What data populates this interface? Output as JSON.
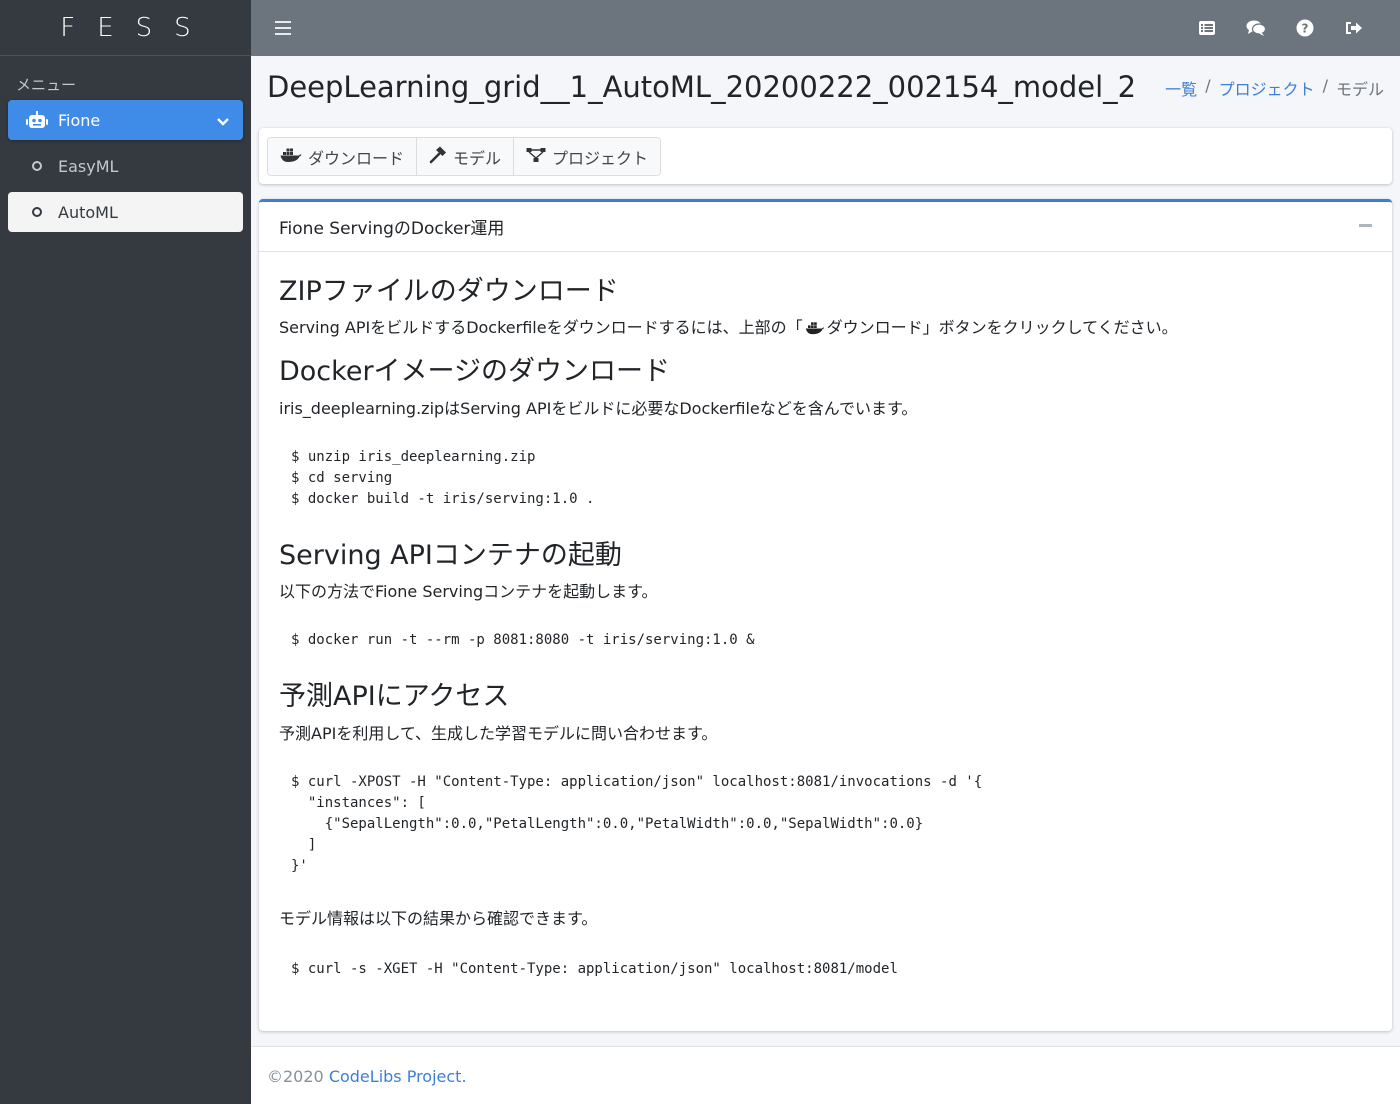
{
  "brand": {
    "text": "FESS"
  },
  "sidebar": {
    "header": "メニュー",
    "items": [
      {
        "label": "Fione"
      },
      {
        "label": "EasyML"
      },
      {
        "label": "AutoML"
      }
    ]
  },
  "header": {
    "title": "DeepLearning_grid__1_AutoML_20200222_002154_model_2",
    "breadcrumb": [
      "一覧",
      "プロジェクト",
      "モデル"
    ]
  },
  "toolbar": {
    "download_label": "ダウンロード",
    "model_label": "モデル",
    "project_label": "プロジェクト"
  },
  "card": {
    "title": "Fione ServingのDocker運用",
    "sections": [
      {
        "heading": "ZIPファイルのダウンロード",
        "text_before": "Serving APIをビルドするDockerfileをダウンロードするには、上部の「",
        "text_after": "ダウンロード」ボタンをクリックしてください。"
      },
      {
        "heading": "Dockerイメージのダウンロード",
        "text": "iris_deeplearning.zipはServing APIをビルドに必要なDockerfileなどを含んでいます。",
        "code": "$ unzip iris_deeplearning.zip\n$ cd serving\n$ docker build -t iris/serving:1.0 ."
      },
      {
        "heading": "Serving APIコンテナの起動",
        "text": "以下の方法でFione Servingコンテナを起動します。",
        "code": "$ docker run -t --rm -p 8081:8080 -t iris/serving:1.0 &"
      },
      {
        "heading": "予測APIにアクセス",
        "text": "予測APIを利用して、生成した学習モデルに問い合わせます。",
        "code": "$ curl -XPOST -H \"Content-Type: application/json\" localhost:8081/invocations -d '{\n  \"instances\": [\n    {\"SepalLength\":0.0,\"PetalLength\":0.0,\"PetalWidth\":0.0,\"SepalWidth\":0.0}\n  ]\n}'",
        "text2": "モデル情報は以下の結果から確認できます。",
        "code2": "$ curl -s -XGET -H \"Content-Type: application/json\" localhost:8081/model"
      }
    ]
  },
  "footer": {
    "copyright": "©2020 ",
    "link": "CodeLibs Project",
    "suffix": "."
  },
  "colors": {
    "sidebar_bg": "#343a40",
    "topbar_bg": "#6c757d",
    "accent": "#3f8be8",
    "link": "#3d7fd6"
  }
}
